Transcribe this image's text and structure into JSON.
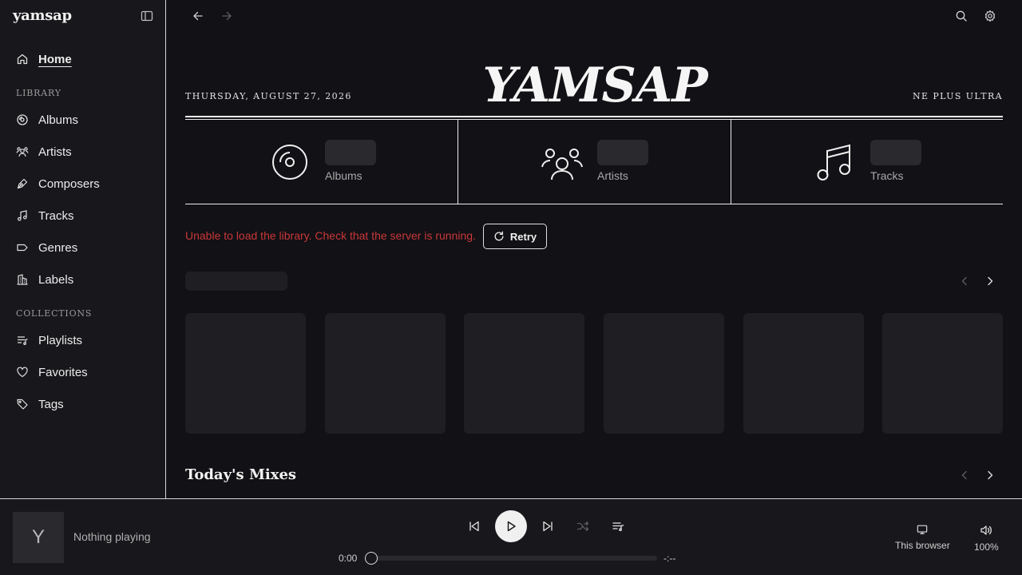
{
  "app": {
    "name": "yamsap"
  },
  "sidebar": {
    "home": {
      "label": "Home",
      "icon": "home-icon"
    },
    "library_heading": "LIBRARY",
    "library": [
      {
        "label": "Albums",
        "icon": "disc-icon"
      },
      {
        "label": "Artists",
        "icon": "users-icon"
      },
      {
        "label": "Composers",
        "icon": "pen-icon"
      },
      {
        "label": "Tracks",
        "icon": "music-note-icon"
      },
      {
        "label": "Genres",
        "icon": "tag-shape-icon"
      },
      {
        "label": "Labels",
        "icon": "building-icon"
      }
    ],
    "collections_heading": "COLLECTIONS",
    "collections": [
      {
        "label": "Playlists",
        "icon": "playlist-icon"
      },
      {
        "label": "Favorites",
        "icon": "heart-icon"
      },
      {
        "label": "Tags",
        "icon": "tag-icon"
      }
    ]
  },
  "masthead": {
    "date": "THURSDAY, AUGUST 27, 2026",
    "logo": "YAMSAP",
    "motto": "NE PLUS ULTRA"
  },
  "stats": [
    {
      "label": "Albums",
      "icon": "disc-icon"
    },
    {
      "label": "Artists",
      "icon": "users-icon"
    },
    {
      "label": "Tracks",
      "icon": "music-note-icon"
    }
  ],
  "error": {
    "message": "Unable to load the library. Check that the server is running.",
    "retry_label": "Retry"
  },
  "sections": {
    "todays_mixes": "Today's Mixes"
  },
  "player": {
    "artwork_letter": "Y",
    "status": "Nothing playing",
    "elapsed": "0:00",
    "remaining": "-:--",
    "progress": 0,
    "device_label": "This browser",
    "volume": "100%"
  },
  "colors": {
    "background": "#121115",
    "sidebar": "#18171b",
    "error": "#c8373a",
    "skeleton": "#1f1e23"
  }
}
